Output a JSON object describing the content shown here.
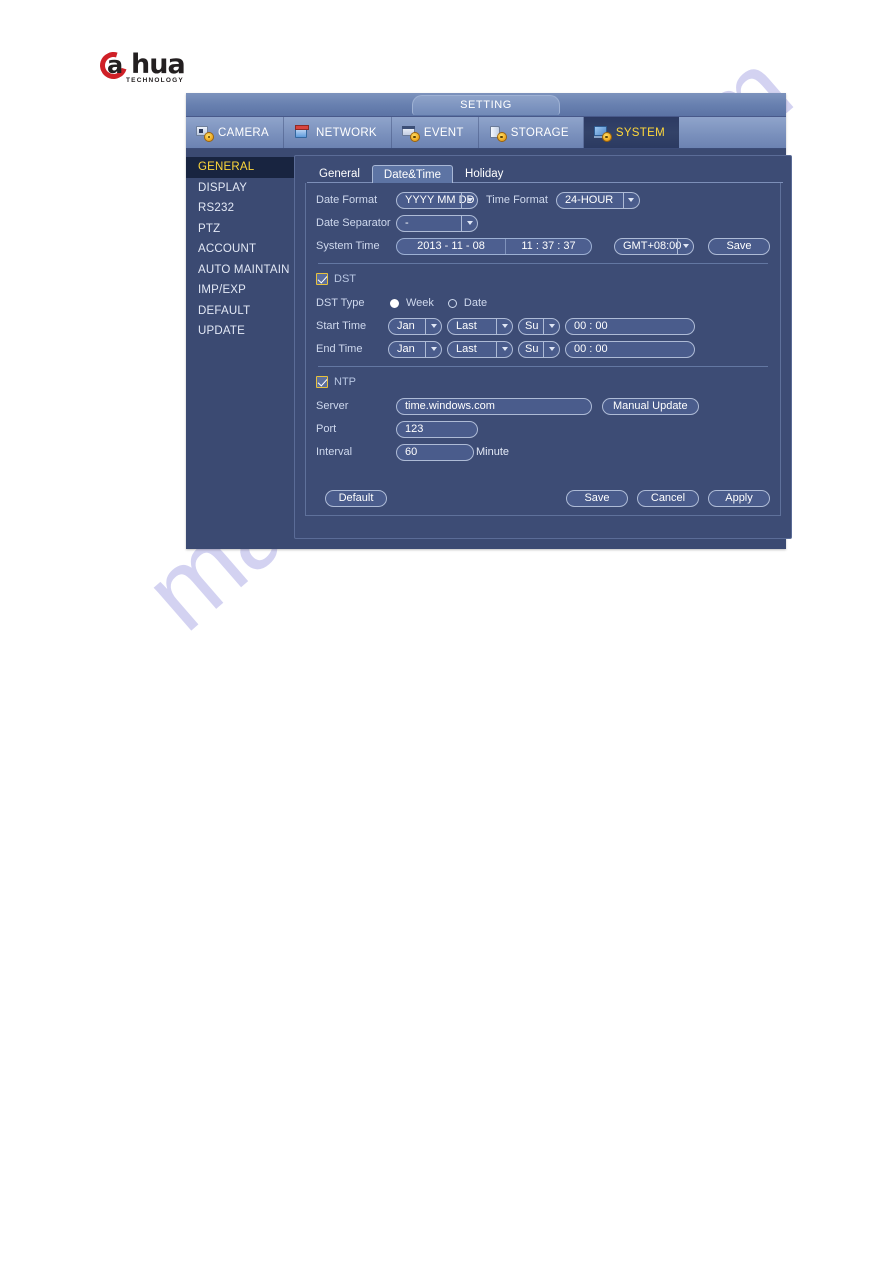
{
  "brand": {
    "name": "alhua",
    "wordmark": "hua",
    "tagline": "TECHNOLOGY"
  },
  "watermark": {
    "text": "manualshive.com"
  },
  "window": {
    "title": "SETTING"
  },
  "nav": {
    "items": [
      {
        "label": "CAMERA",
        "icon": "camera-icon",
        "active": false
      },
      {
        "label": "NETWORK",
        "icon": "network-icon",
        "active": false
      },
      {
        "label": "EVENT",
        "icon": "event-icon",
        "active": false
      },
      {
        "label": "STORAGE",
        "icon": "storage-icon",
        "active": false
      },
      {
        "label": "SYSTEM",
        "icon": "system-icon",
        "active": true
      }
    ]
  },
  "sidebar": {
    "items": [
      {
        "label": "GENERAL",
        "active": true
      },
      {
        "label": "DISPLAY",
        "active": false
      },
      {
        "label": "RS232",
        "active": false
      },
      {
        "label": "PTZ",
        "active": false
      },
      {
        "label": "ACCOUNT",
        "active": false
      },
      {
        "label": "AUTO MAINTAIN",
        "active": false
      },
      {
        "label": "IMP/EXP",
        "active": false
      },
      {
        "label": "DEFAULT",
        "active": false
      },
      {
        "label": "UPDATE",
        "active": false
      }
    ]
  },
  "tabs": [
    {
      "label": "General",
      "active": false
    },
    {
      "label": "Date&Time",
      "active": true
    },
    {
      "label": "Holiday",
      "active": false
    }
  ],
  "form": {
    "date_format": {
      "label": "Date Format",
      "value": "YYYY MM DD"
    },
    "time_format": {
      "label": "Time Format",
      "value": "24-HOUR"
    },
    "date_separator": {
      "label": "Date Separator",
      "value": "-"
    },
    "system_time": {
      "label": "System Time",
      "date": "2013 - 11 - 08",
      "clock": "11 : 37 : 37"
    },
    "timezone": {
      "value": "GMT+08:00"
    },
    "save_time_label": "Save"
  },
  "dst": {
    "enabled_label": "DST",
    "enabled": true,
    "type_label": "DST Type",
    "type_options": [
      {
        "label": "Week",
        "selected": true
      },
      {
        "label": "Date",
        "selected": false
      }
    ],
    "start_time": {
      "label": "Start Time",
      "month": "Jan",
      "week": "Last",
      "day": "Su",
      "time": "00 :  00"
    },
    "end_time": {
      "label": "End Time",
      "month": "Jan",
      "week": "Last",
      "day": "Su",
      "time": "00 :  00"
    }
  },
  "ntp": {
    "enabled_label": "NTP",
    "enabled": true,
    "server": {
      "label": "Server",
      "value": "time.windows.com"
    },
    "manual_update_label": "Manual Update",
    "port": {
      "label": "Port",
      "value": "123"
    },
    "interval": {
      "label": "Interval",
      "value": "60",
      "unit": "Minute"
    }
  },
  "footer": {
    "default_label": "Default",
    "save_label": "Save",
    "cancel_label": "Cancel",
    "apply_label": "Apply"
  },
  "colors": {
    "panel_bg": "#3b4a72",
    "nav_active_bg": "#2c3a63",
    "accent_yellow": "#ffd83a",
    "field_bg": "#4a5c8c",
    "field_border": "#aebbd6",
    "watermark": "#b9b8ea"
  }
}
